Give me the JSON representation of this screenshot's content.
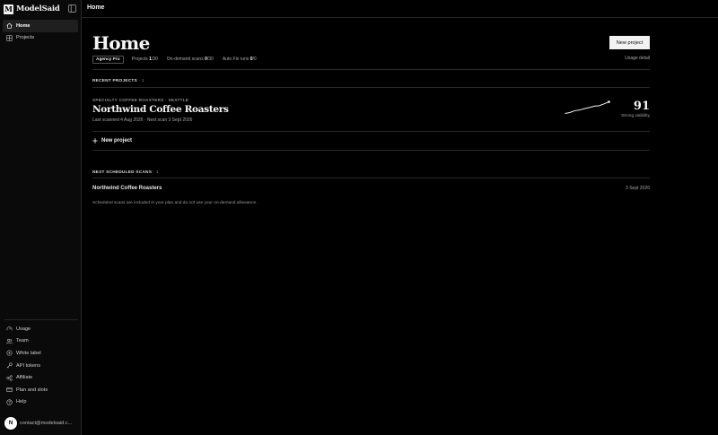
{
  "app": {
    "brand": "ModelSaid",
    "brand_mark": "M"
  },
  "sidebar": {
    "top_items": [
      {
        "label": "Home",
        "icon": "home-icon",
        "active": true
      },
      {
        "label": "Projects",
        "icon": "grid-icon",
        "active": false
      }
    ],
    "bottom_items": [
      {
        "label": "Usage",
        "icon": "gauge-icon"
      },
      {
        "label": "Team",
        "icon": "users-icon"
      },
      {
        "label": "White label",
        "icon": "tag-icon"
      },
      {
        "label": "API tokens",
        "icon": "key-icon"
      },
      {
        "label": "Affiliate",
        "icon": "share-icon"
      },
      {
        "label": "Plan and slots",
        "icon": "card-icon"
      },
      {
        "label": "Help",
        "icon": "help-icon"
      }
    ],
    "user": {
      "avatar_initial": "N",
      "email": "contact@modelsaid.c..."
    }
  },
  "topbar": {
    "title": "Home"
  },
  "header": {
    "title": "Home",
    "new_project_label": "New project",
    "plan_badge": "Agency Pro",
    "stats": [
      {
        "label": "Projects",
        "used": "1",
        "total": "/30"
      },
      {
        "label": "On-demand scans",
        "used": "0",
        "total": "/30"
      },
      {
        "label": "Auto Fix runs",
        "used": "0",
        "total": "/0"
      }
    ],
    "usage_link": "Usage detail"
  },
  "recent": {
    "label": "RECENT PROJECTS",
    "count": " · 1",
    "projects": [
      {
        "eyebrow": "SPECIALTY COFFEE ROASTERS · SEATTLE",
        "name": "Northwind Coffee Roasters",
        "scan_info": "Last scanned 4 Aug 2026 · Next scan 3 Sept 2026",
        "score": "91",
        "score_label": "Strong visibility",
        "trend": [
          40,
          44,
          52,
          55,
          61,
          66,
          72,
          74,
          82,
          91
        ]
      }
    ],
    "add_label": "New project"
  },
  "scheduled": {
    "label": "NEXT SCHEDULED SCANS",
    "count": " · 1",
    "items": [
      {
        "name": "Northwind Coffee Roasters",
        "date": "3 Sept 2026"
      }
    ],
    "note": "Scheduled scans are included in your plan and do not use your on-demand allowance."
  },
  "colors": {
    "background": "#000000",
    "sidebar": "#0a0a0a",
    "active_nav": "#1f1f1f",
    "button": "#f2f2f2",
    "text": "#e8e8e8"
  }
}
